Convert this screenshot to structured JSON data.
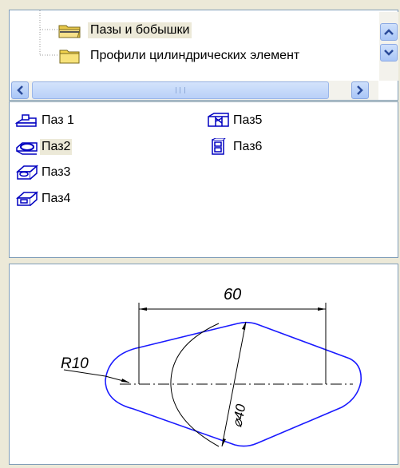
{
  "tree": {
    "items": [
      {
        "label": "Пазы и бобышки",
        "selected": true
      },
      {
        "label": "Профили цилиндрических элемент",
        "selected": false
      }
    ],
    "scroll_grip": "III"
  },
  "list": {
    "items": [
      {
        "label": "Паз 1",
        "icon": "slot-1-icon"
      },
      {
        "label": "Паз2",
        "icon": "slot-2-icon",
        "selected": true
      },
      {
        "label": "Паз3",
        "icon": "slot-3-icon"
      },
      {
        "label": "Паз4",
        "icon": "slot-4-icon"
      },
      {
        "label": "Паз5",
        "icon": "slot-5-icon"
      },
      {
        "label": "Паз6",
        "icon": "slot-6-icon"
      }
    ]
  },
  "preview": {
    "dim_length": "60",
    "dim_radius": "R10",
    "dim_diameter": "⌀40",
    "line_color": "#1a1aff"
  }
}
